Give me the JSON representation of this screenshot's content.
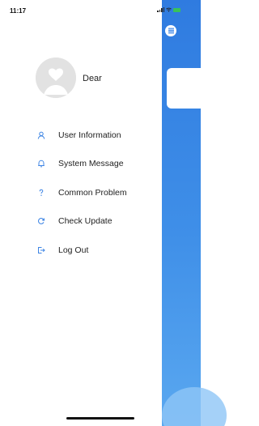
{
  "status_bar": {
    "time": "11:17"
  },
  "profile": {
    "name": "Dear",
    "avatar_icon": "avatar-placeholder-icon"
  },
  "menu": [
    {
      "label": "User Information",
      "icon": "user-icon"
    },
    {
      "label": "System Message",
      "icon": "bell-icon"
    },
    {
      "label": "Common Problem",
      "icon": "question-icon"
    },
    {
      "label": "Check Update",
      "icon": "refresh-icon"
    },
    {
      "label": "Log Out",
      "icon": "logout-icon"
    }
  ],
  "colors": {
    "accent": "#3d84e4",
    "background_app": "#2f7be0"
  }
}
